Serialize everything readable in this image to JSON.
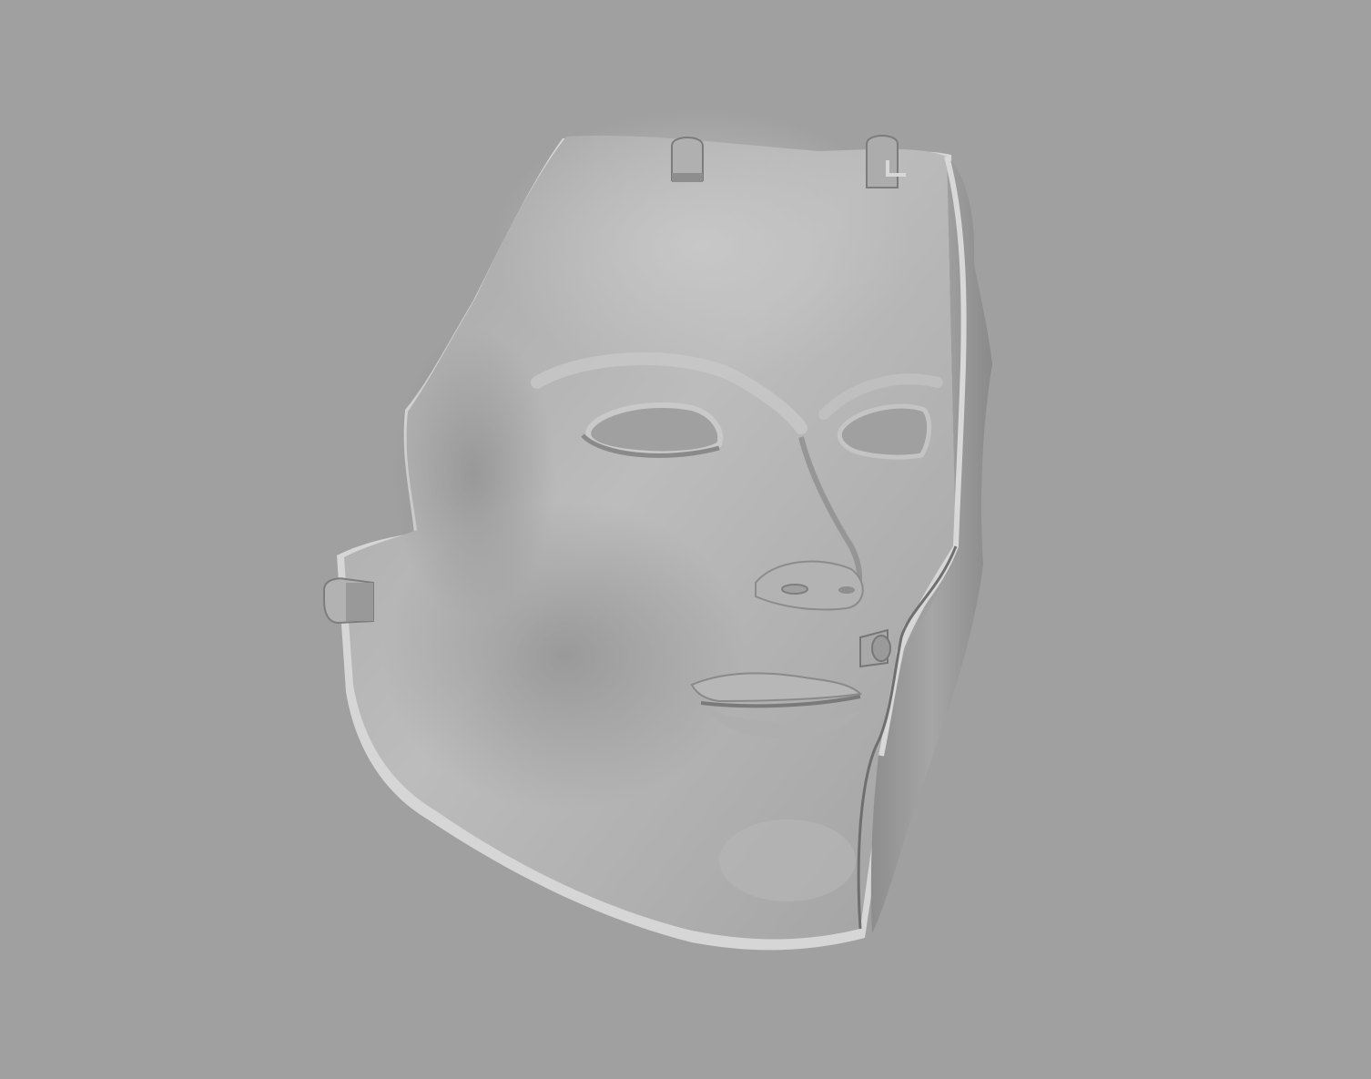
{
  "viewport": {
    "background_color": "#a0a0a0"
  },
  "model": {
    "subject": "3d-face-mask-render",
    "shading": "grey-clay",
    "colors": {
      "surface_light": "#bdbdbd",
      "surface_mid": "#a9a9a9",
      "surface_dark": "#767676",
      "rim": "#d8d8d8",
      "hole_fill": "#a0a0a0"
    },
    "parts": [
      "mask-main-shell",
      "mask-right-section",
      "left-eye-hole",
      "right-eye-hole",
      "nostril-hole",
      "mouth-lips",
      "top-mount-tab-left",
      "top-mount-tab-right",
      "side-mount-tab",
      "mouth-corner-peg"
    ]
  }
}
